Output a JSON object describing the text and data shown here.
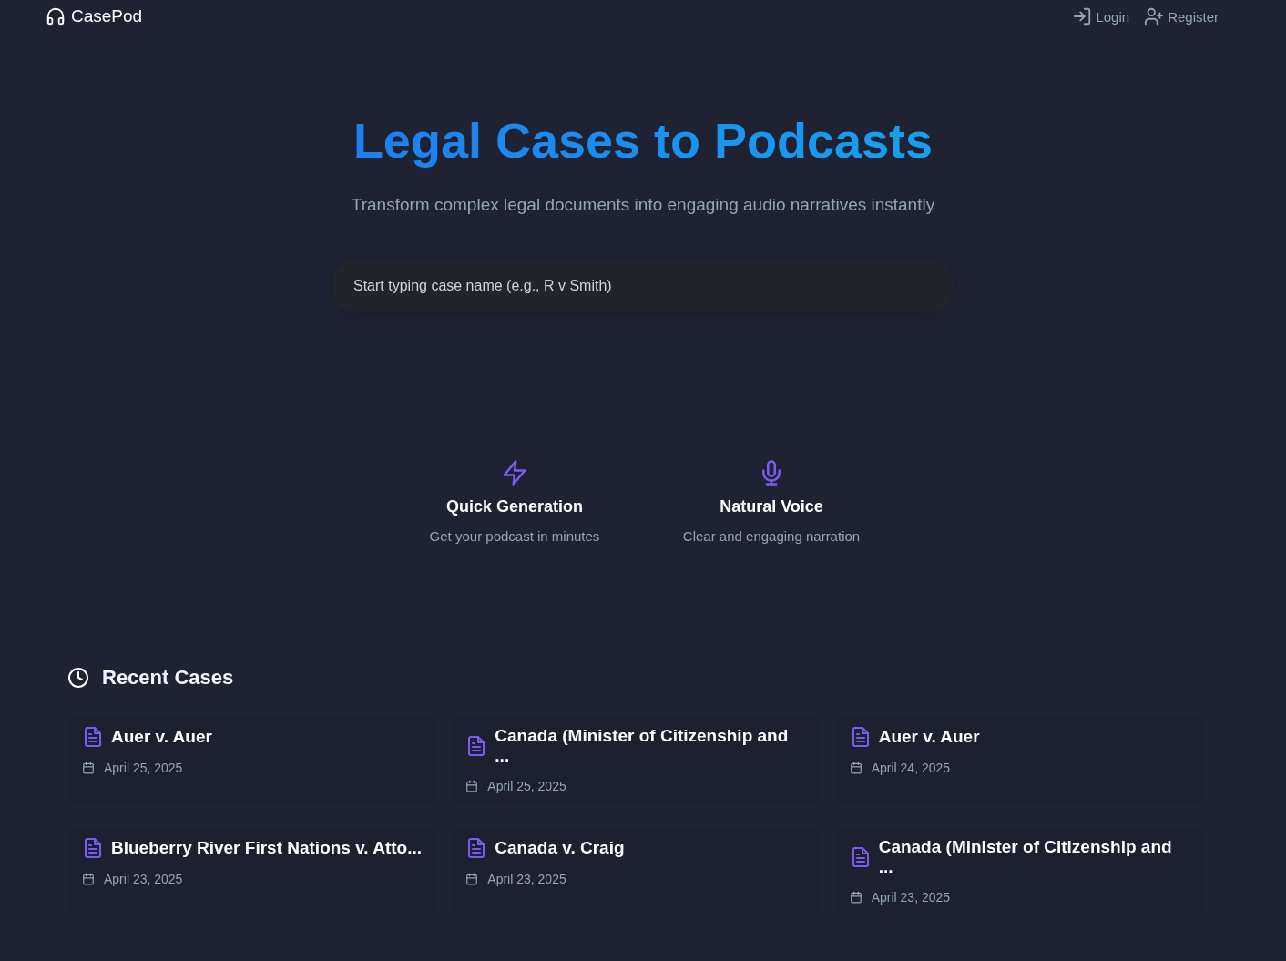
{
  "header": {
    "logo": "CasePod",
    "nav": [
      {
        "kind": "login",
        "label": "Login"
      },
      {
        "kind": "register",
        "label": "Register"
      }
    ]
  },
  "hero": {
    "title": "Legal Cases to Podcasts",
    "subtitle": "Transform complex legal documents into engaging audio narratives instantly",
    "search": {
      "placeholder": "Start typing case name (e.g., R v Smith)"
    }
  },
  "features": [
    {
      "kind": "bolt",
      "title": "Quick Generation",
      "description": "Get your podcast in minutes"
    },
    {
      "kind": "mic",
      "title": "Natural Voice",
      "description": "Clear and engaging narration"
    }
  ],
  "recent_cases": {
    "title": "Recent Cases",
    "items": [
      {
        "title": "Auer v. Auer",
        "date": "April 25, 2025"
      },
      {
        "title": "Canada (Minister of Citizenship and ...",
        "date": "April 25, 2025"
      },
      {
        "title": "Auer v. Auer",
        "date": "April 24, 2025"
      },
      {
        "title": "Blueberry River First Nations v. Atto...",
        "date": "April 23, 2025"
      },
      {
        "title": "Canada v. Craig",
        "date": "April 23, 2025"
      },
      {
        "title": "Canada (Minister of Citizenship and ...",
        "date": "April 23, 2025"
      }
    ]
  }
}
